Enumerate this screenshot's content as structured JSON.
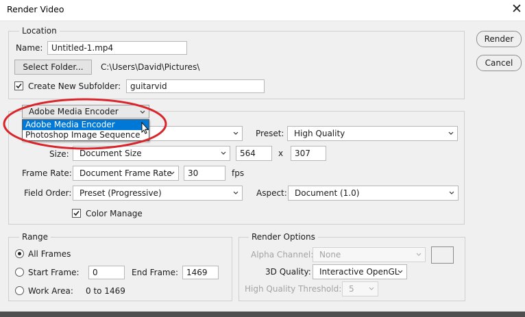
{
  "window": {
    "title": "Render Video"
  },
  "buttons": {
    "render": "Render",
    "cancel": "Cancel"
  },
  "location": {
    "legend": "Location",
    "name_label": "Name:",
    "name_value": "Untitled-1.mp4",
    "select_folder": "Select Folder...",
    "folder_path": "C:\\Users\\David\\Pictures\\",
    "create_subfolder_label": "Create New Subfolder:",
    "create_subfolder_checked": true,
    "subfolder_value": "guitarvid"
  },
  "encoder": {
    "selected": "Adobe Media Encoder",
    "options": [
      "Adobe Media Encoder",
      "Photoshop Image Sequence"
    ],
    "highlighted_option": "Adobe Media Encoder",
    "format_value": "",
    "preset_label": "Preset:",
    "preset_value": "High Quality",
    "size_label": "Size:",
    "size_value": "Document Size",
    "width": "564",
    "x_sep": "x",
    "height": "307",
    "frame_rate_label": "Frame Rate:",
    "frame_rate_value": "Document Frame Rate",
    "fps_value": "30",
    "fps_unit": "fps",
    "field_order_label": "Field Order:",
    "field_order_value": "Preset (Progressive)",
    "aspect_label": "Aspect:",
    "aspect_value": "Document (1.0)",
    "color_manage_label": "Color Manage",
    "color_manage_checked": true
  },
  "range": {
    "legend": "Range",
    "all_frames": "All Frames",
    "start_frame_label": "Start Frame:",
    "start_frame_value": "0",
    "end_frame_label": "End Frame:",
    "end_frame_value": "1469",
    "work_area_label": "Work Area:",
    "work_area_value": "0 to 1469",
    "selected": "All Frames"
  },
  "render_options": {
    "legend": "Render Options",
    "alpha_label": "Alpha Channel:",
    "alpha_value": "None",
    "quality_label": "3D Quality:",
    "quality_value": "Interactive OpenGL",
    "threshold_label": "High Quality Threshold:",
    "threshold_value": "5"
  },
  "colors": {
    "highlight": "#0078d7",
    "annotation_ellipse": "#d9262c"
  },
  "icons": {
    "close": "close-icon",
    "cursor": "mouse-pointer-icon",
    "dropdown": "chevron-down-icon"
  }
}
